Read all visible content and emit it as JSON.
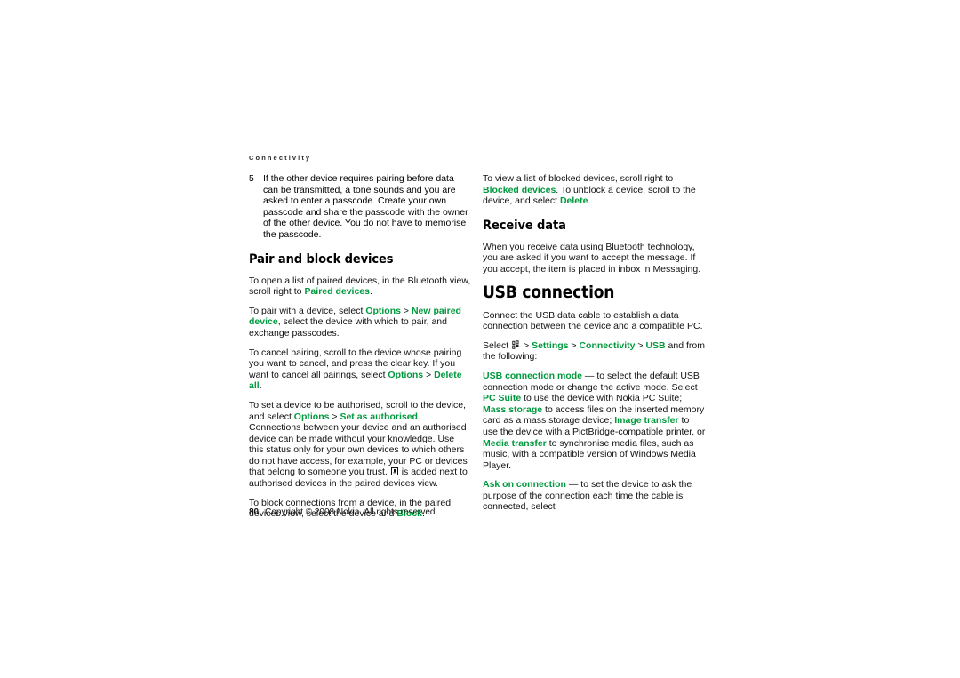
{
  "running_head": "Connectivity",
  "colors": {
    "accent_green": "#009a3d",
    "text": "#111111",
    "background": "#ffffff"
  },
  "left_column": {
    "step": {
      "number": "5",
      "text": "If the other device requires pairing before data can be transmitted, a tone sounds and you are asked to enter a passcode. Create your own passcode and share the passcode with the owner of the other device. You do not have to memorise the passcode."
    },
    "heading": "Pair and block devices",
    "p1_a": "To open a list of paired devices, in the Bluetooth view, scroll right to ",
    "p1_term": "Paired devices",
    "p1_b": ".",
    "p2_a": "To pair with a device, select ",
    "p2_term1": "Options",
    "p2_sep": " > ",
    "p2_term2": "New paired device",
    "p2_b": ", select the device with which to pair, and exchange passcodes.",
    "p3_a": "To cancel pairing, scroll to the device whose pairing you want to cancel, and press the clear key. If you want to cancel all pairings, select ",
    "p3_term1": "Options",
    "p3_sep": " > ",
    "p3_term2": "Delete all",
    "p3_b": ".",
    "p4_a": "To set a device to be authorised, scroll to the device, and select ",
    "p4_term1": "Options",
    "p4_sep": " > ",
    "p4_term2": "Set as authorised",
    "p4_b": ". Connections between your device and an authorised device can be made without your knowledge. Use this status only for your own devices to which others do not have access, for example, your PC or devices that belong to someone you trust. ",
    "p4_icon": "authorised-device-icon",
    "p4_c": " is added next to authorised devices in the paired devices view.",
    "p5_a": "To block connections from a device, in the paired devices view, select the device and ",
    "p5_term": "Block",
    "p5_b": "."
  },
  "right_column": {
    "p1_a": "To view a list of blocked devices, scroll right to ",
    "p1_term1": "Blocked devices",
    "p1_b": ". To unblock a device, scroll to the device, and select ",
    "p1_term2": "Delete",
    "p1_c": ".",
    "heading_receive": "Receive data",
    "p2": "When you receive data using Bluetooth technology, you are asked if you want to accept the message. If you accept, the item is placed in inbox in Messaging.",
    "heading_usb": "USB connection",
    "p3": "Connect the USB data cable to establish a data connection between the device and a compatible PC.",
    "p4_a": "Select ",
    "p4_icon": "menu-key-icon",
    "p4_sep1": " > ",
    "p4_term1": "Settings",
    "p4_sep2": " > ",
    "p4_term2": "Connectivity",
    "p4_sep3": " > ",
    "p4_term3": "USB",
    "p4_b": " and from the following:",
    "p5_term": "USB connection mode",
    "p5_a": " — to select the default USB connection mode or change the active mode. Select ",
    "p5_term2": "PC Suite",
    "p5_b": " to use the device with Nokia PC Suite; ",
    "p5_term3": "Mass storage",
    "p5_c": " to access files on the inserted memory card as a mass storage device; ",
    "p5_term4": "Image transfer",
    "p5_d": " to use the device with a PictBridge-compatible printer, or ",
    "p5_term5": "Media transfer",
    "p5_e": " to synchronise media files, such as music, with a compatible version of Windows Media Player.",
    "p6_term": "Ask on connection",
    "p6_a": " — to set the device to ask the purpose of the connection each time the cable is connected, select"
  },
  "footer": {
    "page_number": "80",
    "copyright": "Copyright © 2008 Nokia. All rights reserved."
  }
}
